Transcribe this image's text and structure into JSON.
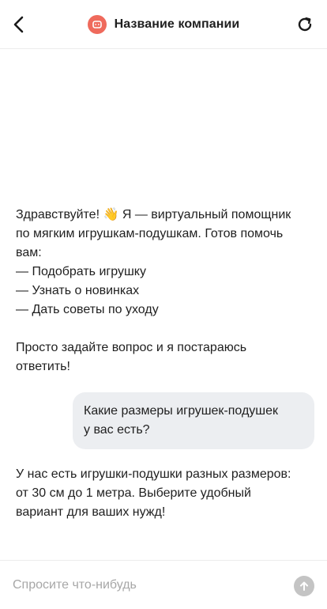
{
  "header": {
    "title": "Название компании",
    "back_icon": "chevron-left-icon",
    "refresh_icon": "refresh-icon",
    "logo_icon": "chat-bot-icon",
    "logo_color": "#ef6a5c"
  },
  "messages": {
    "welcome": {
      "line1": "Здравствуйте! 👋 Я — виртуальный помощник",
      "line2": "по мягким игрушкам-подушкам. Готов помочь",
      "line3": "вам:",
      "item1": "— Подобрать игрушку",
      "item2": "— Узнать о новинках",
      "item3": "— Дать советы по уходу",
      "line4": "Просто задайте вопрос и я постараюсь",
      "line5": "ответить!"
    },
    "user_question": {
      "line1": "Какие размеры игрушек-подушек",
      "line2": "у вас есть?"
    },
    "bot_answer": {
      "line1": "У нас есть игрушки-подушки разных размеров:",
      "line2": "от 30 см до 1 метра. Выберите удобный",
      "line3": "вариант для ваших нужд!"
    }
  },
  "composer": {
    "placeholder": "Спросите что-нибудь",
    "send_icon": "arrow-up-icon",
    "send_color": "#c4c4c4"
  }
}
